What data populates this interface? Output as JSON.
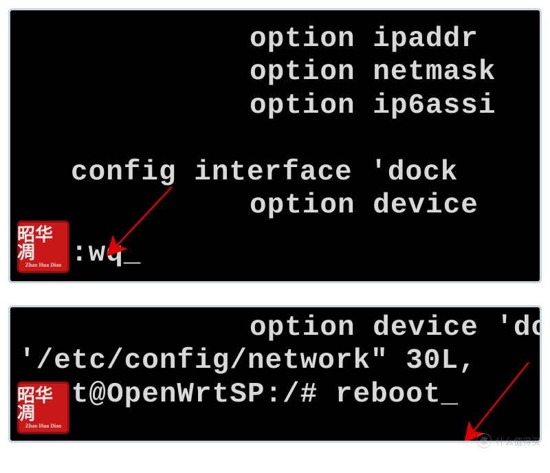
{
  "top_panel": {
    "lines": [
      {
        "indent": "indent-2",
        "text": "option ipaddr "
      },
      {
        "indent": "indent-2",
        "text": "option netmask"
      },
      {
        "indent": "indent-2",
        "text": "option ip6assi"
      },
      {
        "indent": "",
        "text": " "
      },
      {
        "indent": "indent-1",
        "text": "config interface 'dock"
      },
      {
        "indent": "indent-2",
        "text": "option device "
      }
    ],
    "command": ":wq_"
  },
  "bottom_panel": {
    "lines": [
      {
        "indent": "indent-2",
        "text": "option device 'doc"
      },
      {
        "indent": "",
        "text": "'/etc/config/network\" 30L,"
      }
    ],
    "prompt": "root@OpenWrtSP:/# reboot_"
  },
  "seal": {
    "text": "昭华凋",
    "pinyin": "Zhao Hua Diao"
  },
  "watermark": {
    "icon": "值",
    "text": "什么值得买"
  }
}
